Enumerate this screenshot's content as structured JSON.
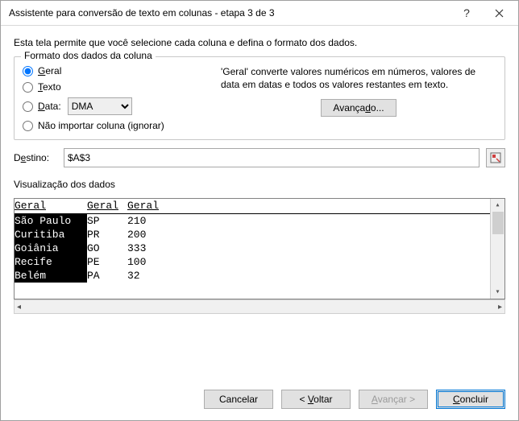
{
  "title": "Assistente para conversão de texto em colunas - etapa 3 de 3",
  "instruction": "Esta tela permite que você selecione cada coluna e defina o formato dos dados.",
  "format_group": {
    "legend": "Formato dos dados da coluna",
    "radios": {
      "general": "Geral",
      "text": "Texto",
      "date": "Data:",
      "skip": "Não importar coluna (ignorar)"
    },
    "date_value": "DMA",
    "description": "'Geral' converte valores numéricos em números, valores de data em datas e todos os valores restantes em texto.",
    "advanced": "Avançado..."
  },
  "destination": {
    "label": "Destino:",
    "value": "$A$3"
  },
  "preview": {
    "label": "Visualização dos dados",
    "headers": [
      "Geral",
      "Geral",
      "Geral"
    ],
    "rows": [
      {
        "c1": "São Paulo",
        "c2": "SP",
        "c3": "210"
      },
      {
        "c1": "Curitiba",
        "c2": "PR",
        "c3": "200"
      },
      {
        "c1": "Goiânia",
        "c2": "GO",
        "c3": "333"
      },
      {
        "c1": "Recife",
        "c2": "PE",
        "c3": "100"
      },
      {
        "c1": "Belém",
        "c2": "PA",
        "c3": "32"
      }
    ]
  },
  "buttons": {
    "cancel": "Cancelar",
    "back": "< Voltar",
    "next": "Avançar >",
    "finish": "Concluir"
  }
}
